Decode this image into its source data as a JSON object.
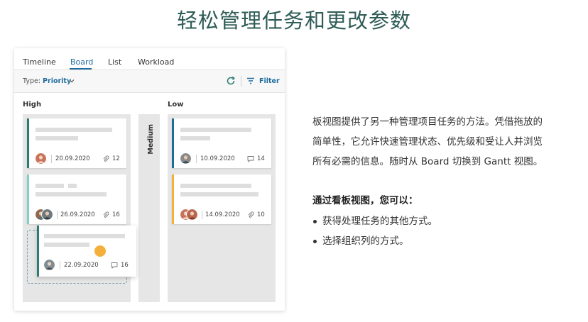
{
  "heading": "轻松管理任务和更改参数",
  "tabs": [
    {
      "label": "Timeline",
      "active": false
    },
    {
      "label": "Board",
      "active": true
    },
    {
      "label": "List",
      "active": false
    },
    {
      "label": "Workload",
      "active": false
    }
  ],
  "toolbar": {
    "type_label": "Type: ",
    "type_value": "Priority",
    "filter_label": "Filter"
  },
  "columns": {
    "high": "High",
    "medium": "Medium",
    "low": "Low"
  },
  "cards": [
    {
      "date": "20.09.2020",
      "count_icon": "paperclip-icon",
      "count": "12",
      "bar_color": "#2a7d72"
    },
    {
      "date": "26.09.2020",
      "count_icon": "paperclip-icon",
      "count": "16",
      "bar_color": "#7fd0c8"
    },
    {
      "date": "22.09.2020",
      "count_icon": "comment-icon",
      "count": "16",
      "bar_color": "#2a7d72"
    },
    {
      "date": "10.09.2020",
      "count_icon": "comment-icon",
      "count": "14",
      "bar_color": "#1f6c9e"
    },
    {
      "date": "14.09.2020",
      "count_icon": "paperclip-icon",
      "count": "10",
      "bar_color": "#f5b03c"
    }
  ],
  "description": {
    "lines": [
      "板视图提供了另一种管理项目任务的方法。凭借拖放的",
      "简单性，它允许快速管理状态、优先级和受让人并浏览",
      "所有必需的信息。随时从 Board 切换到 Gantt 视图。"
    ],
    "subhead": "通过看板视图，您可以：",
    "bullets": [
      "获得处理任务的其他方式。",
      "选择组织列的方式。"
    ]
  },
  "colors": {
    "accent": "#1f6c9e",
    "heading": "#2f5c56",
    "drag_indicator": "#f5b03c"
  }
}
